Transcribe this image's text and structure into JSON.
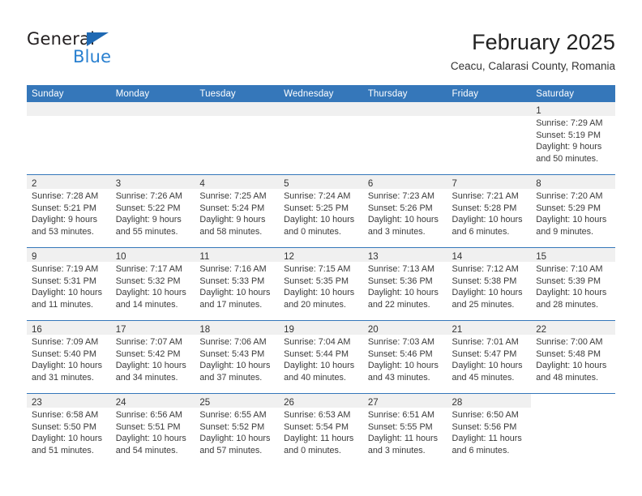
{
  "brand": {
    "name_top": "General",
    "name_bottom": "Blue",
    "accent_color": "#2980d0",
    "triangle_color": "#1f69b3"
  },
  "header": {
    "title": "February 2025",
    "subtitle": "Ceacu, Calarasi County, Romania"
  },
  "theme": {
    "header_row_bg": "#3577ba",
    "date_band_bg": "#f0f0f0",
    "text_color": "#333333"
  },
  "weekday_headers": [
    "Sunday",
    "Monday",
    "Tuesday",
    "Wednesday",
    "Thursday",
    "Friday",
    "Saturday"
  ],
  "labels": {
    "sunrise": "Sunrise:",
    "sunset": "Sunset:",
    "daylight": "Daylight:"
  },
  "weeks": [
    [
      {
        "day": "",
        "empty": true
      },
      {
        "day": "",
        "empty": true
      },
      {
        "day": "",
        "empty": true
      },
      {
        "day": "",
        "empty": true
      },
      {
        "day": "",
        "empty": true
      },
      {
        "day": "",
        "empty": true
      },
      {
        "day": "1",
        "sunrise": "Sunrise: 7:29 AM",
        "sunset": "Sunset: 5:19 PM",
        "daylight1": "Daylight: 9 hours",
        "daylight2": "and 50 minutes."
      }
    ],
    [
      {
        "day": "2",
        "sunrise": "Sunrise: 7:28 AM",
        "sunset": "Sunset: 5:21 PM",
        "daylight1": "Daylight: 9 hours",
        "daylight2": "and 53 minutes."
      },
      {
        "day": "3",
        "sunrise": "Sunrise: 7:26 AM",
        "sunset": "Sunset: 5:22 PM",
        "daylight1": "Daylight: 9 hours",
        "daylight2": "and 55 minutes."
      },
      {
        "day": "4",
        "sunrise": "Sunrise: 7:25 AM",
        "sunset": "Sunset: 5:24 PM",
        "daylight1": "Daylight: 9 hours",
        "daylight2": "and 58 minutes."
      },
      {
        "day": "5",
        "sunrise": "Sunrise: 7:24 AM",
        "sunset": "Sunset: 5:25 PM",
        "daylight1": "Daylight: 10 hours",
        "daylight2": "and 0 minutes."
      },
      {
        "day": "6",
        "sunrise": "Sunrise: 7:23 AM",
        "sunset": "Sunset: 5:26 PM",
        "daylight1": "Daylight: 10 hours",
        "daylight2": "and 3 minutes."
      },
      {
        "day": "7",
        "sunrise": "Sunrise: 7:21 AM",
        "sunset": "Sunset: 5:28 PM",
        "daylight1": "Daylight: 10 hours",
        "daylight2": "and 6 minutes."
      },
      {
        "day": "8",
        "sunrise": "Sunrise: 7:20 AM",
        "sunset": "Sunset: 5:29 PM",
        "daylight1": "Daylight: 10 hours",
        "daylight2": "and 9 minutes."
      }
    ],
    [
      {
        "day": "9",
        "sunrise": "Sunrise: 7:19 AM",
        "sunset": "Sunset: 5:31 PM",
        "daylight1": "Daylight: 10 hours",
        "daylight2": "and 11 minutes."
      },
      {
        "day": "10",
        "sunrise": "Sunrise: 7:17 AM",
        "sunset": "Sunset: 5:32 PM",
        "daylight1": "Daylight: 10 hours",
        "daylight2": "and 14 minutes."
      },
      {
        "day": "11",
        "sunrise": "Sunrise: 7:16 AM",
        "sunset": "Sunset: 5:33 PM",
        "daylight1": "Daylight: 10 hours",
        "daylight2": "and 17 minutes."
      },
      {
        "day": "12",
        "sunrise": "Sunrise: 7:15 AM",
        "sunset": "Sunset: 5:35 PM",
        "daylight1": "Daylight: 10 hours",
        "daylight2": "and 20 minutes."
      },
      {
        "day": "13",
        "sunrise": "Sunrise: 7:13 AM",
        "sunset": "Sunset: 5:36 PM",
        "daylight1": "Daylight: 10 hours",
        "daylight2": "and 22 minutes."
      },
      {
        "day": "14",
        "sunrise": "Sunrise: 7:12 AM",
        "sunset": "Sunset: 5:38 PM",
        "daylight1": "Daylight: 10 hours",
        "daylight2": "and 25 minutes."
      },
      {
        "day": "15",
        "sunrise": "Sunrise: 7:10 AM",
        "sunset": "Sunset: 5:39 PM",
        "daylight1": "Daylight: 10 hours",
        "daylight2": "and 28 minutes."
      }
    ],
    [
      {
        "day": "16",
        "sunrise": "Sunrise: 7:09 AM",
        "sunset": "Sunset: 5:40 PM",
        "daylight1": "Daylight: 10 hours",
        "daylight2": "and 31 minutes."
      },
      {
        "day": "17",
        "sunrise": "Sunrise: 7:07 AM",
        "sunset": "Sunset: 5:42 PM",
        "daylight1": "Daylight: 10 hours",
        "daylight2": "and 34 minutes."
      },
      {
        "day": "18",
        "sunrise": "Sunrise: 7:06 AM",
        "sunset": "Sunset: 5:43 PM",
        "daylight1": "Daylight: 10 hours",
        "daylight2": "and 37 minutes."
      },
      {
        "day": "19",
        "sunrise": "Sunrise: 7:04 AM",
        "sunset": "Sunset: 5:44 PM",
        "daylight1": "Daylight: 10 hours",
        "daylight2": "and 40 minutes."
      },
      {
        "day": "20",
        "sunrise": "Sunrise: 7:03 AM",
        "sunset": "Sunset: 5:46 PM",
        "daylight1": "Daylight: 10 hours",
        "daylight2": "and 43 minutes."
      },
      {
        "day": "21",
        "sunrise": "Sunrise: 7:01 AM",
        "sunset": "Sunset: 5:47 PM",
        "daylight1": "Daylight: 10 hours",
        "daylight2": "and 45 minutes."
      },
      {
        "day": "22",
        "sunrise": "Sunrise: 7:00 AM",
        "sunset": "Sunset: 5:48 PM",
        "daylight1": "Daylight: 10 hours",
        "daylight2": "and 48 minutes."
      }
    ],
    [
      {
        "day": "23",
        "sunrise": "Sunrise: 6:58 AM",
        "sunset": "Sunset: 5:50 PM",
        "daylight1": "Daylight: 10 hours",
        "daylight2": "and 51 minutes."
      },
      {
        "day": "24",
        "sunrise": "Sunrise: 6:56 AM",
        "sunset": "Sunset: 5:51 PM",
        "daylight1": "Daylight: 10 hours",
        "daylight2": "and 54 minutes."
      },
      {
        "day": "25",
        "sunrise": "Sunrise: 6:55 AM",
        "sunset": "Sunset: 5:52 PM",
        "daylight1": "Daylight: 10 hours",
        "daylight2": "and 57 minutes."
      },
      {
        "day": "26",
        "sunrise": "Sunrise: 6:53 AM",
        "sunset": "Sunset: 5:54 PM",
        "daylight1": "Daylight: 11 hours",
        "daylight2": "and 0 minutes."
      },
      {
        "day": "27",
        "sunrise": "Sunrise: 6:51 AM",
        "sunset": "Sunset: 5:55 PM",
        "daylight1": "Daylight: 11 hours",
        "daylight2": "and 3 minutes."
      },
      {
        "day": "28",
        "sunrise": "Sunrise: 6:50 AM",
        "sunset": "Sunset: 5:56 PM",
        "daylight1": "Daylight: 11 hours",
        "daylight2": "and 6 minutes."
      },
      {
        "day": "",
        "empty": true,
        "no_band": true
      }
    ]
  ]
}
